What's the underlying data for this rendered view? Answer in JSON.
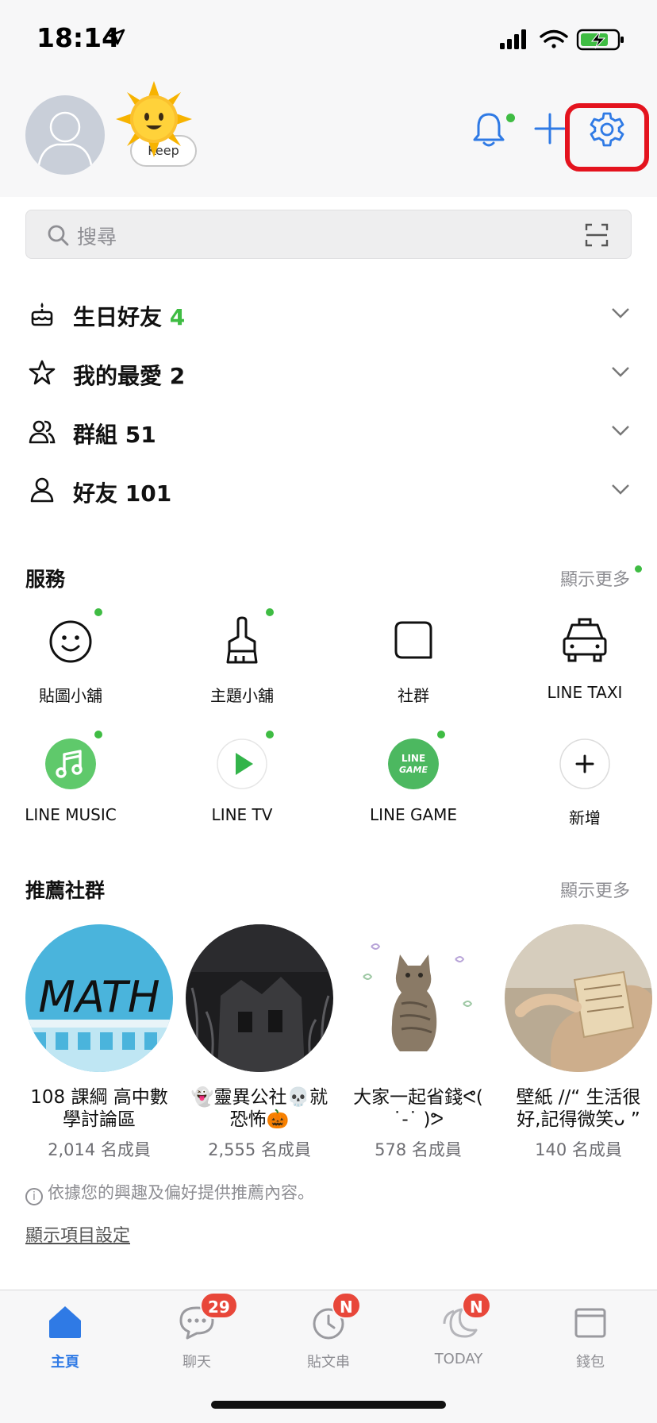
{
  "status_bar": {
    "time": "18:14"
  },
  "profile": {
    "status_text": "Keep"
  },
  "search": {
    "placeholder": "搜尋"
  },
  "fold_rows": [
    {
      "label": "生日好友",
      "count": "4",
      "count_color": "#3fbc43"
    },
    {
      "label": "我的最愛",
      "count": "2"
    },
    {
      "label": "群組",
      "count": "51"
    },
    {
      "label": "好友",
      "count": "101"
    }
  ],
  "services": {
    "title": "服務",
    "more": "顯示更多",
    "items": [
      {
        "label": "貼圖小舖",
        "icon": "smile-icon",
        "new_dot": true
      },
      {
        "label": "主題小舖",
        "icon": "brush-icon",
        "new_dot": true
      },
      {
        "label": "社群",
        "icon": "square-chat-icon",
        "new_dot": false
      },
      {
        "label": "LINE TAXI",
        "icon": "taxi-icon",
        "new_dot": false
      },
      {
        "label": "LINE MUSIC",
        "icon": "music-icon",
        "new_dot": true
      },
      {
        "label": "LINE TV",
        "icon": "play-icon",
        "new_dot": true
      },
      {
        "label": "LINE GAME",
        "icon": "game-icon",
        "icon_text": "LINE GAME",
        "new_dot": true
      },
      {
        "label": "新增",
        "icon": "plus-icon",
        "new_dot": false
      }
    ]
  },
  "recommended": {
    "title": "推薦社群",
    "more": "顯示更多",
    "items": [
      {
        "name": "108 課綱 高中數學討論區",
        "members": "2,014 名成員",
        "thumb_text": "MATH"
      },
      {
        "name": "👻靈異公社💀就恐怖🎃",
        "members": "2,555 名成員"
      },
      {
        "name": "大家一起省錢ᕙ( ˙-˙ )ᕗ",
        "members": "578 名成員"
      },
      {
        "name": "壁紙 //“ 生活很好,記得微笑ᴗ ”",
        "members": "140 名成員"
      }
    ],
    "info": "依據您的興趣及偏好提供推薦內容。",
    "settings_link": "顯示項目設定"
  },
  "tabbar": [
    {
      "label": "主頁",
      "icon": "home-icon",
      "active": true
    },
    {
      "label": "聊天",
      "icon": "chat-icon",
      "badge": "29"
    },
    {
      "label": "貼文串",
      "icon": "clock-icon",
      "badge": "N"
    },
    {
      "label": "TODAY",
      "icon": "today-icon",
      "badge": "N"
    },
    {
      "label": "錢包",
      "icon": "wallet-icon"
    }
  ],
  "colors": {
    "accent": "#2f7ae5",
    "line_green": "#3fbc43",
    "badge_red": "#e8473a",
    "highlight_red": "#e4131e"
  }
}
